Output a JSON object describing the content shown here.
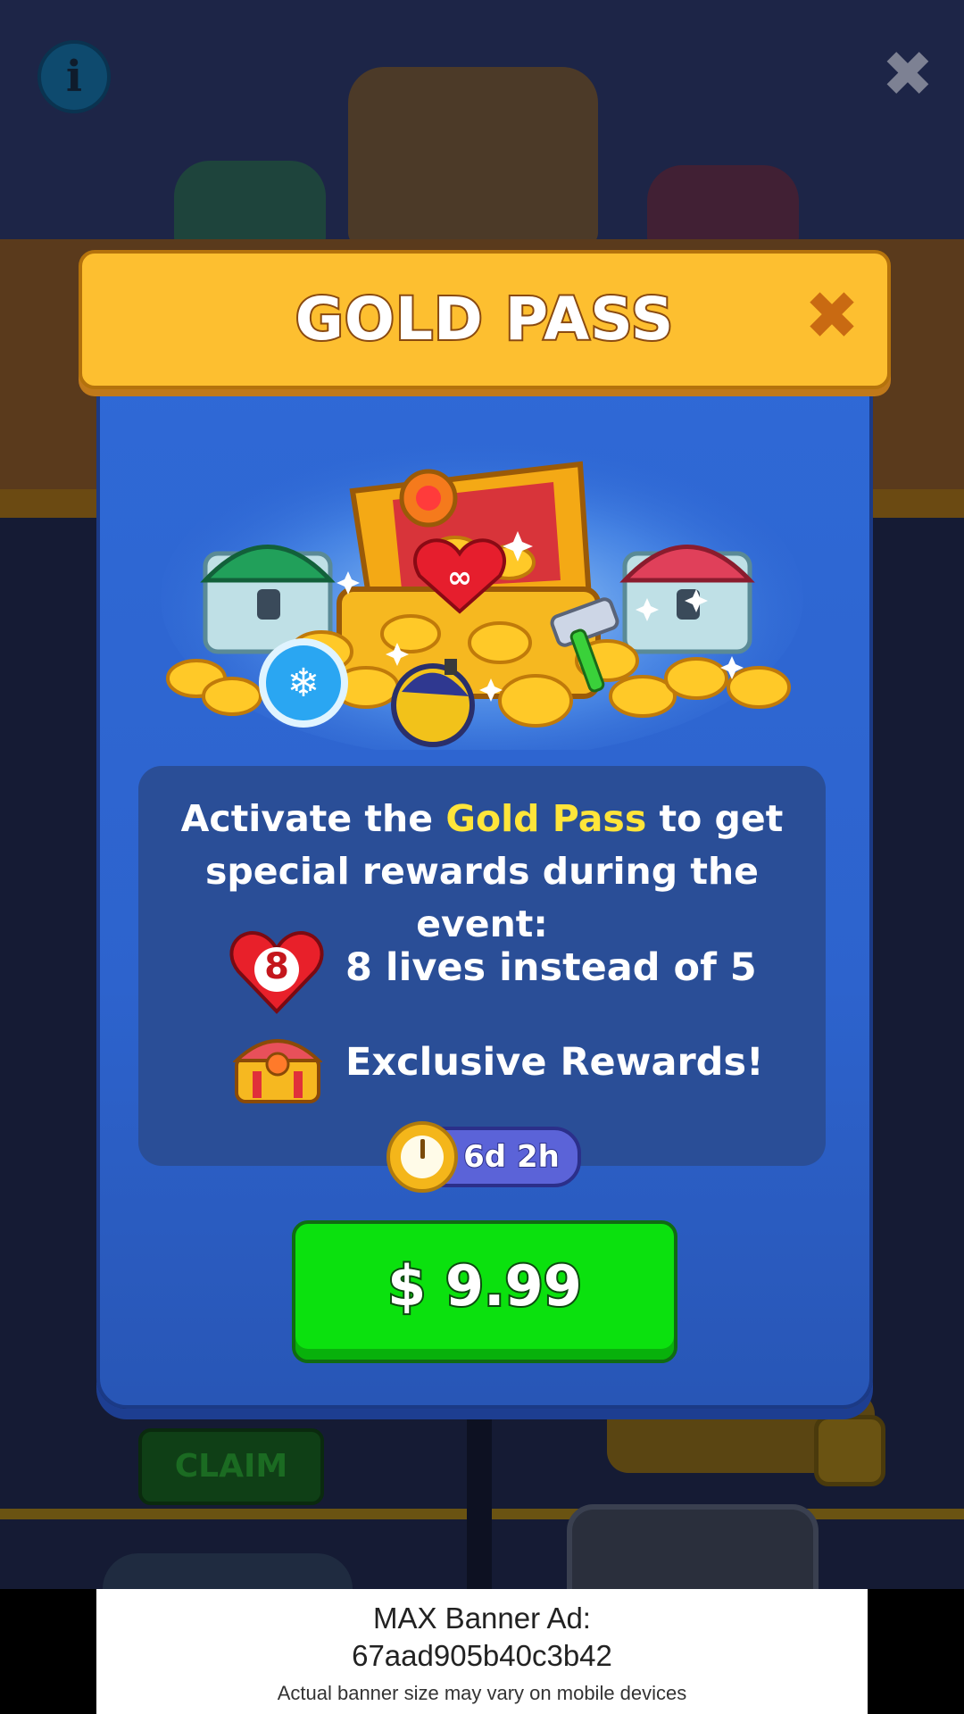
{
  "background": {
    "claim_label": "CLAIM"
  },
  "top_bar": {
    "info_icon": "info-icon",
    "close_icon": "close-icon"
  },
  "modal": {
    "title": "GOLD PASS",
    "close_icon": "close-icon",
    "description_part1": "Activate the ",
    "description_highlight": "Gold Pass",
    "description_part2": " to get special rewards during the event:",
    "benefits": [
      {
        "icon": "heart-icon",
        "badge": "8",
        "label": "8 lives instead of 5"
      },
      {
        "icon": "treasure-chest-icon",
        "label": "Exclusive Rewards!"
      }
    ],
    "timer": {
      "icon": "stopwatch-icon",
      "text": "6d 2h"
    },
    "price_button": "$ 9.99",
    "colors": {
      "header": "#fdbf30",
      "body": "#2f69d6",
      "price_button": "#0be10e",
      "highlight": "#ffe53a"
    }
  },
  "ad_banner": {
    "title": "MAX Banner Ad:",
    "ad_id": "67aad905b40c3b42",
    "note": "Actual banner size may vary on mobile devices"
  }
}
